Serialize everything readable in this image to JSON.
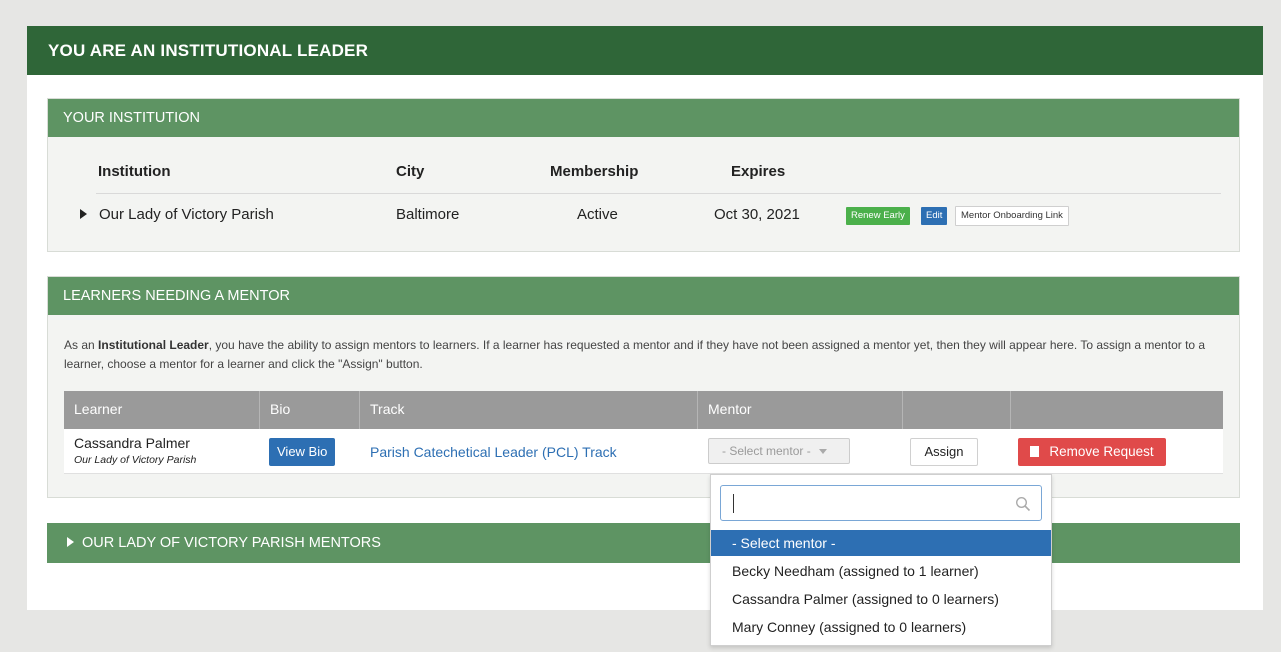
{
  "page_title": "YOU ARE AN INSTITUTIONAL LEADER",
  "institution_panel": {
    "title": "YOUR INSTITUTION",
    "headers": {
      "institution": "Institution",
      "city": "City",
      "membership": "Membership",
      "expires": "Expires"
    },
    "row": {
      "institution": "Our Lady of Victory Parish",
      "city": "Baltimore",
      "membership": "Active",
      "expires": "Oct 30, 2021"
    },
    "buttons": {
      "renew": "Renew Early",
      "edit": "Edit",
      "onboarding": "Mentor Onboarding Link"
    }
  },
  "learners_panel": {
    "title": "LEARNERS NEEDING A MENTOR",
    "desc_prefix": "As an ",
    "desc_bold": "Institutional Leader",
    "desc_rest": ", you have the ability to assign mentors to learners. If a learner has requested a mentor and if they have not been assigned a mentor yet, then they will appear here. To assign a mentor to a learner, choose a mentor for a learner and click the \"Assign\" button.",
    "columns": {
      "learner": "Learner",
      "bio": "Bio",
      "track": "Track",
      "mentor": "Mentor"
    },
    "row": {
      "learner_name": "Cassandra Palmer",
      "learner_institution": "Our Lady of Victory Parish",
      "view_bio": "View Bio",
      "track": "Parish Catechetical Leader (PCL) Track",
      "select_value": "- Select mentor -",
      "assign": "Assign",
      "remove": "Remove Request"
    }
  },
  "mentors_panel": {
    "title": "OUR LADY OF VICTORY PARISH MENTORS"
  },
  "dropdown": {
    "search_value": "",
    "options": [
      "- Select mentor -",
      "Becky Needham (assigned to 1 learner)",
      "Cassandra Palmer (assigned to 0 learners)",
      "Mary Conney (assigned to 0 learners)"
    ],
    "selected_index": 0
  },
  "colors": {
    "dark_green": "#2f6638",
    "panel_green": "#5e9463",
    "blue": "#2d6fb3",
    "red": "#e04a4a",
    "green_btn": "#4bb04b"
  }
}
